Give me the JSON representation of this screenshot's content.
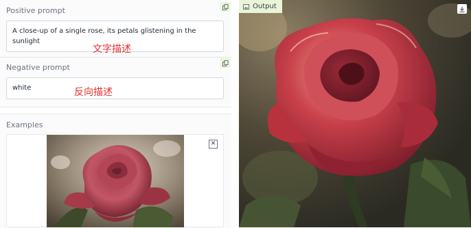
{
  "positive": {
    "label": "Positive prompt",
    "value": "A close-up of a single rose, its petals glistening in the sunlight"
  },
  "negative": {
    "label": "Negative prompt",
    "value": "white"
  },
  "annotations": {
    "positive_note": "文字描述",
    "negative_note": "反向描述"
  },
  "examples": {
    "label": "Examples",
    "toggle": "▼",
    "close": "✕"
  },
  "output": {
    "label": "Output"
  },
  "colors": {
    "accent_tag": "#e8f5d6",
    "annotation_red": "#e03131"
  },
  "icons": [
    "copy-icon",
    "image-icon",
    "download-icon",
    "close-icon",
    "collapse-triangle-icon"
  ]
}
